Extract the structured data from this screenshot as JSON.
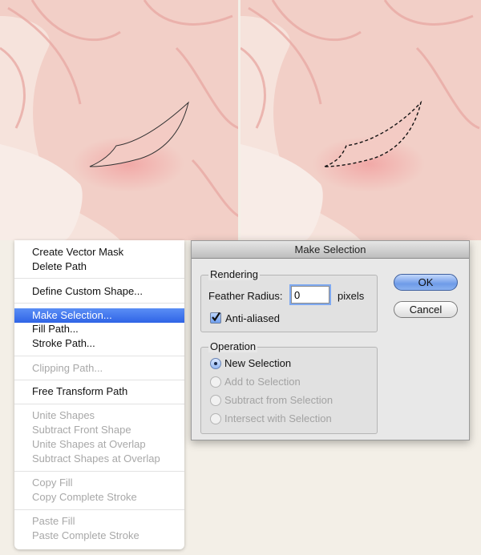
{
  "menu": {
    "items": [
      {
        "label": "Create Vector Mask",
        "enabled": true
      },
      {
        "label": "Delete Path",
        "enabled": true
      },
      {
        "label": "Define Custom Shape...",
        "enabled": true
      },
      {
        "label": "Make Selection...",
        "enabled": true,
        "selected": true
      },
      {
        "label": "Fill Path...",
        "enabled": true
      },
      {
        "label": "Stroke Path...",
        "enabled": true
      },
      {
        "label": "Clipping Path...",
        "enabled": false
      },
      {
        "label": "Free Transform Path",
        "enabled": true
      },
      {
        "label": "Unite Shapes",
        "enabled": false
      },
      {
        "label": "Subtract Front Shape",
        "enabled": false
      },
      {
        "label": "Unite Shapes at Overlap",
        "enabled": false
      },
      {
        "label": "Subtract Shapes at Overlap",
        "enabled": false
      },
      {
        "label": "Copy Fill",
        "enabled": false
      },
      {
        "label": "Copy Complete Stroke",
        "enabled": false
      },
      {
        "label": "Paste Fill",
        "enabled": false
      },
      {
        "label": "Paste Complete Stroke",
        "enabled": false
      }
    ]
  },
  "dialog": {
    "title": "Make Selection",
    "rendering": {
      "group_label": "Rendering",
      "feather_label": "Feather Radius:",
      "feather_value": "0",
      "feather_unit": "pixels",
      "anti_aliased_label": "Anti-aliased",
      "anti_aliased_checked": true
    },
    "operation": {
      "group_label": "Operation",
      "options": [
        {
          "label": "New Selection",
          "selected": true,
          "enabled": true
        },
        {
          "label": "Add to Selection",
          "selected": false,
          "enabled": false
        },
        {
          "label": "Subtract from Selection",
          "selected": false,
          "enabled": false
        },
        {
          "label": "Intersect with Selection",
          "selected": false,
          "enabled": false
        }
      ]
    },
    "ok_label": "OK",
    "cancel_label": "Cancel"
  },
  "colors": {
    "background": "#f3efe7",
    "menu_highlight": "#2f64e6",
    "skin": "#f5dad3",
    "blush": "#f2a6a6",
    "hair_lines": "#e9aaa5"
  }
}
